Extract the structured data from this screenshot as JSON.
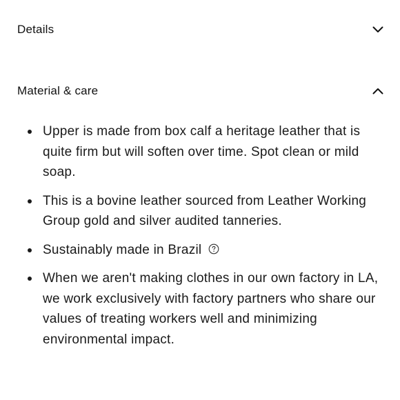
{
  "sections": {
    "details": {
      "title": "Details",
      "expanded": false,
      "icon": "chevron-down-icon"
    },
    "material_care": {
      "title": "Material & care",
      "expanded": true,
      "icon": "chevron-up-icon",
      "items": [
        {
          "text": "Upper is made from box calf a heritage leather that is quite firm but will soften over time. Spot clean or mild soap."
        },
        {
          "text": "This is a bovine leather sourced from Leather Working Group gold and silver audited tanneries."
        },
        {
          "text": "Sustainably made in Brazil",
          "icon": "help-circle-icon"
        },
        {
          "text": "When we aren't making clothes in our own factory in LA, we work exclusively with factory partners who share our values of treating workers well and minimizing environmental impact."
        }
      ]
    }
  }
}
